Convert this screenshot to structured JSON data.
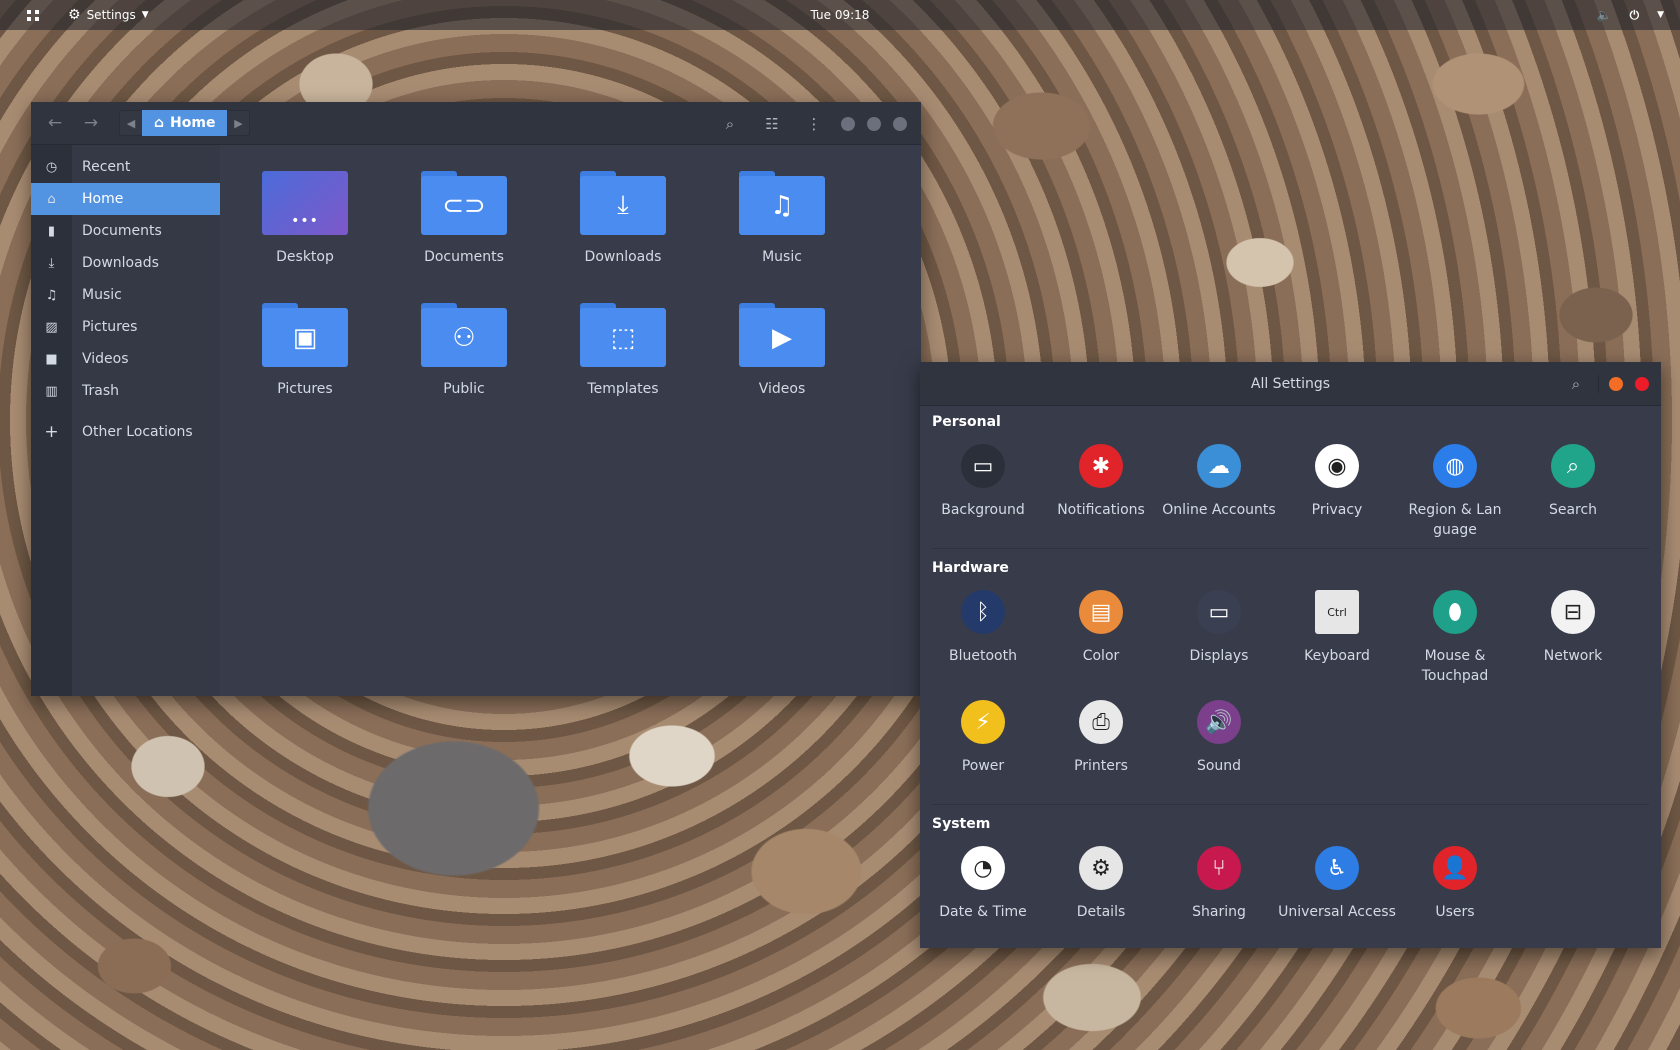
{
  "topbar": {
    "app_name": "Settings",
    "clock": "Tue 09:18"
  },
  "files": {
    "location": "Home",
    "sidebar": [
      {
        "label": "Recent",
        "icon": "clock-icon",
        "glyph": "◷"
      },
      {
        "label": "Home",
        "icon": "home-icon",
        "glyph": "⌂",
        "active": true
      },
      {
        "label": "Documents",
        "icon": "document-icon",
        "glyph": "▮"
      },
      {
        "label": "Downloads",
        "icon": "download-icon",
        "glyph": "⤓"
      },
      {
        "label": "Music",
        "icon": "music-icon",
        "glyph": "♫"
      },
      {
        "label": "Pictures",
        "icon": "picture-icon",
        "glyph": "▨"
      },
      {
        "label": "Videos",
        "icon": "video-icon",
        "glyph": "■"
      },
      {
        "label": "Trash",
        "icon": "trash-icon",
        "glyph": "▥"
      }
    ],
    "other_locations": "Other Locations",
    "folders": [
      {
        "label": "Desktop",
        "glyph": "•••"
      },
      {
        "label": "Documents",
        "glyph": "⊂⊃"
      },
      {
        "label": "Downloads",
        "glyph": "⤓"
      },
      {
        "label": "Music",
        "glyph": "♫"
      },
      {
        "label": "Pictures",
        "glyph": "▣"
      },
      {
        "label": "Public",
        "glyph": "⚇"
      },
      {
        "label": "Templates",
        "glyph": "⬚"
      },
      {
        "label": "Videos",
        "glyph": "▶"
      }
    ]
  },
  "settings": {
    "title": "All Settings",
    "sections": {
      "personal": "Personal",
      "hardware": "Hardware",
      "system": "System"
    },
    "personal": [
      {
        "label": "Background",
        "icon": "background-icon",
        "glyph": "▭",
        "color": "#2b2f3a"
      },
      {
        "label": "Notifications",
        "icon": "notifications-icon",
        "glyph": "✱",
        "color": "#e0242a"
      },
      {
        "label": "Online Accounts",
        "icon": "cloud-icon",
        "glyph": "☁",
        "color": "#3b8fd6"
      },
      {
        "label": "Privacy",
        "icon": "privacy-eye-icon",
        "glyph": "◉",
        "color": "#ffffff"
      },
      {
        "label": "Region & Lan guage",
        "icon": "globe-icon",
        "glyph": "◍",
        "color": "#2b7de9"
      },
      {
        "label": "Search",
        "icon": "search-icon",
        "glyph": "⌕",
        "color": "#21a58a"
      }
    ],
    "hardware": [
      {
        "label": "Bluetooth",
        "icon": "bluetooth-icon",
        "glyph": "ᛒ",
        "color": "#243a6b"
      },
      {
        "label": "Color",
        "icon": "color-icon",
        "glyph": "▤",
        "color": "#e98b3a"
      },
      {
        "label": "Displays",
        "icon": "displays-icon",
        "glyph": "▭",
        "color": "#3a3f52"
      },
      {
        "label": "Keyboard",
        "icon": "keyboard-icon",
        "glyph": "Ctrl",
        "color": "#e6e6e6"
      },
      {
        "label": "Mouse & Touchpad",
        "icon": "mouse-icon",
        "glyph": "⬮",
        "color": "#1fa08a"
      },
      {
        "label": "Network",
        "icon": "network-icon",
        "glyph": "⊟",
        "color": "#f2f2f2"
      },
      {
        "label": "Power",
        "icon": "power-icon",
        "glyph": "⚡",
        "color": "#f2c01d"
      },
      {
        "label": "Printers",
        "icon": "printer-icon",
        "glyph": "⎙",
        "color": "#e9e9e9"
      },
      {
        "label": "Sound",
        "icon": "sound-icon",
        "glyph": "🔊",
        "color": "#7b3f8c"
      }
    ],
    "system": [
      {
        "label": "Date & Time",
        "icon": "clock-icon",
        "glyph": "◔",
        "color": "#ffffff"
      },
      {
        "label": "Details",
        "icon": "gear-icon",
        "glyph": "⚙",
        "color": "#e6e6e6"
      },
      {
        "label": "Sharing",
        "icon": "sharing-icon",
        "glyph": "⑂",
        "color": "#c8194f"
      },
      {
        "label": "Universal Access",
        "icon": "accessibility-icon",
        "glyph": "♿",
        "color": "#2d7de4"
      },
      {
        "label": "Users",
        "icon": "users-icon",
        "glyph": "👤",
        "color": "#e0242a"
      }
    ]
  },
  "colors": {
    "accent": "#5294e2",
    "window_bg": "#383c4a",
    "header_bg": "#2f343f",
    "minimize": "#f46d25",
    "close": "#ec1c28"
  }
}
